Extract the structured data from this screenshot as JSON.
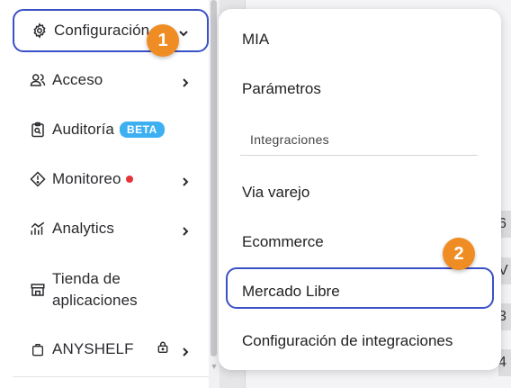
{
  "sidebar": {
    "items": [
      {
        "label": "Configuración",
        "icon": "gear-icon",
        "chevron": "chevron-down-icon"
      },
      {
        "label": "Acceso",
        "icon": "users-icon",
        "chevron": "chevron-right-icon"
      },
      {
        "label": "Auditoría",
        "icon": "clipboard-search-icon",
        "badge": "BETA"
      },
      {
        "label": "Monitoreo",
        "icon": "diamond-alert-icon",
        "chevron": "chevron-right-icon",
        "status": "red-dot"
      },
      {
        "label": "Analytics",
        "icon": "chart-icon",
        "chevron": "chevron-right-icon"
      },
      {
        "label_line1": "Tienda de",
        "label_line2": "aplicaciones",
        "icon": "store-icon"
      },
      {
        "label": "ANYSHELF",
        "icon": "bag-icon",
        "lock": "lock-icon",
        "chevron": "chevron-right-icon"
      }
    ]
  },
  "steps": {
    "one": "1",
    "two": "2"
  },
  "menu": {
    "items": [
      "MIA",
      "Parámetros"
    ],
    "section_label": "Integraciones",
    "integrations": [
      "Via varejo",
      "Ecommerce",
      "Mercado Libre",
      "Configuración de integraciones"
    ]
  },
  "colors": {
    "accent_outline": "#3a50c6",
    "step_badge": "#f08c24",
    "beta_badge": "#3db0f2",
    "alert_dot": "#e8323a"
  }
}
